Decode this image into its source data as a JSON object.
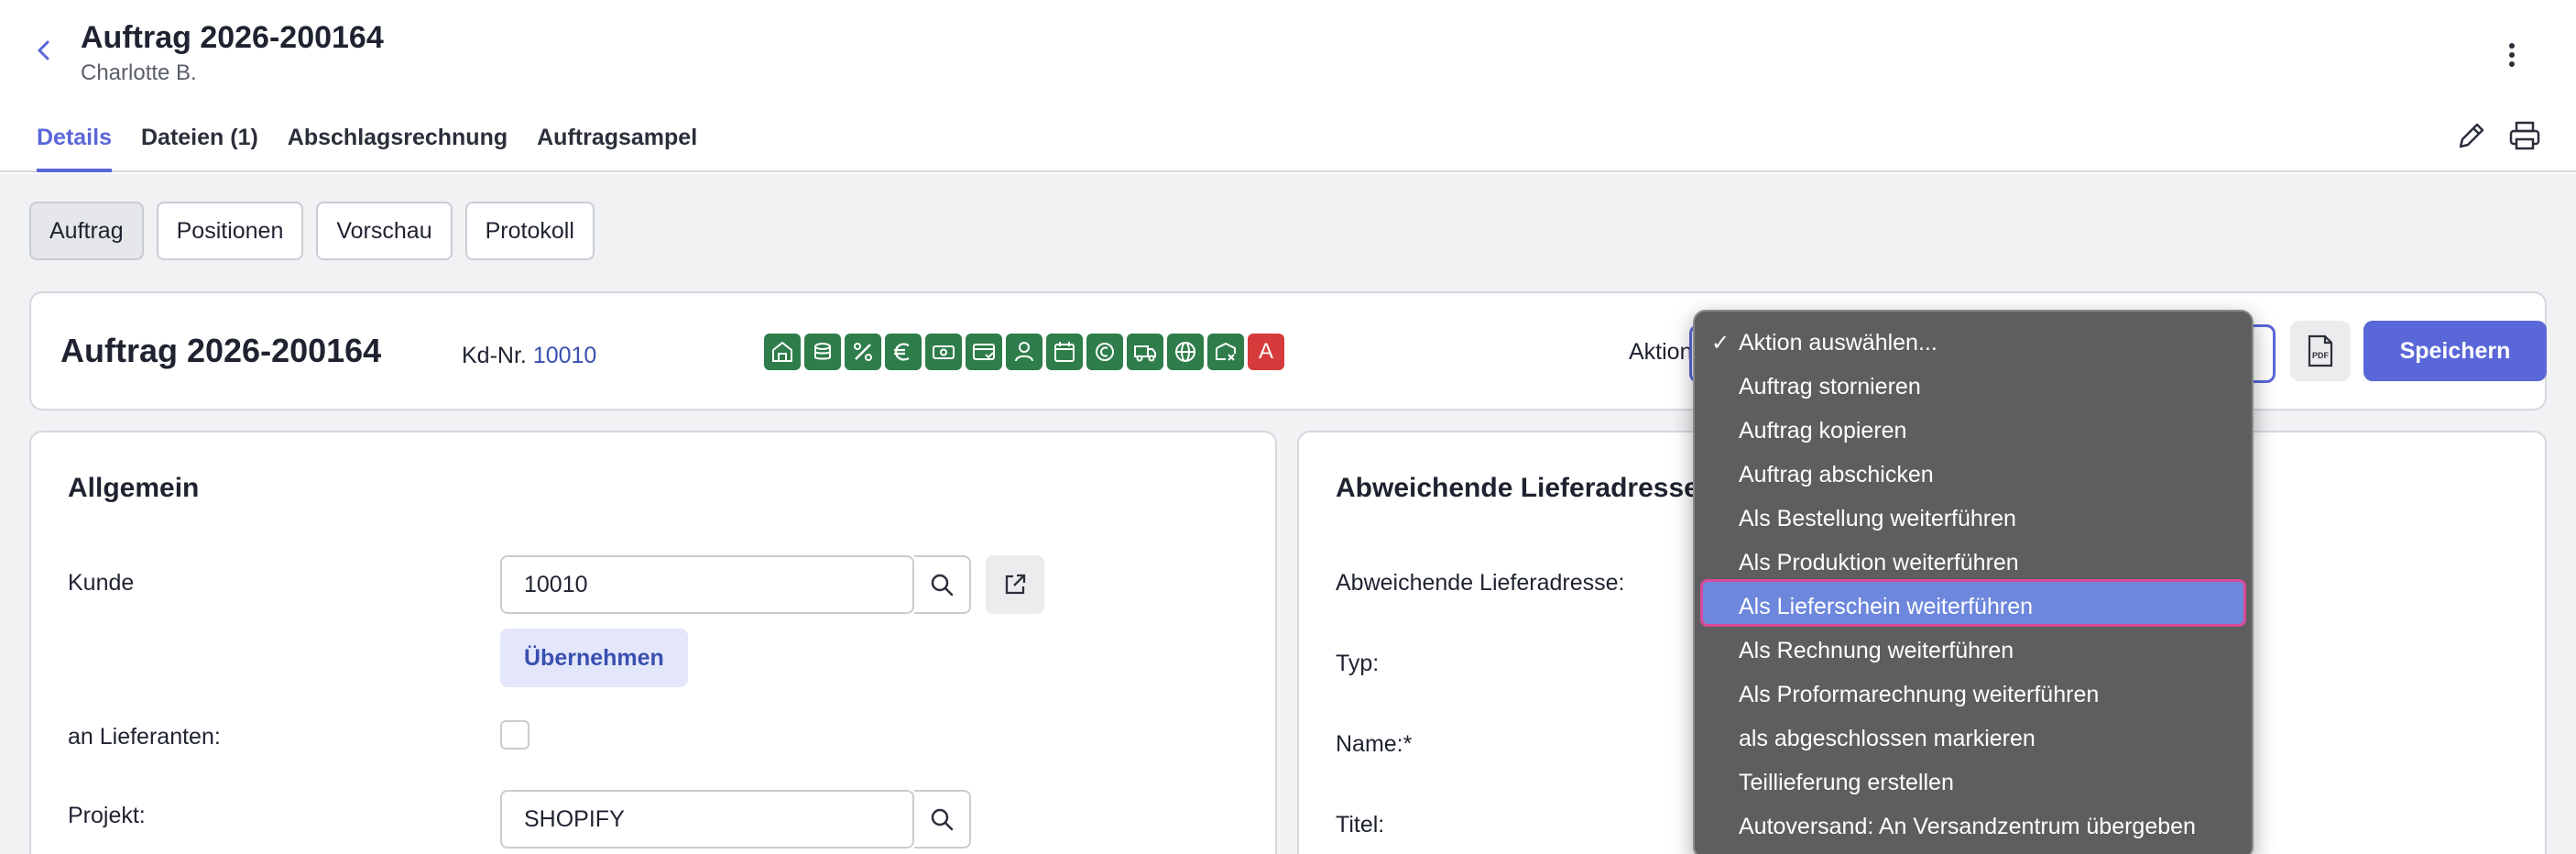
{
  "header": {
    "title": "Auftrag 2026-200164",
    "subtitle": "Charlotte B.",
    "tabs": [
      {
        "label": "Details",
        "active": true
      },
      {
        "label": "Dateien (1)",
        "active": false
      },
      {
        "label": "Abschlagsrechnung",
        "active": false
      },
      {
        "label": "Auftragsampel",
        "active": false
      }
    ]
  },
  "subtabs": [
    {
      "label": "Auftrag",
      "active": true
    },
    {
      "label": "Positionen",
      "active": false
    },
    {
      "label": "Vorschau",
      "active": false
    },
    {
      "label": "Protokoll",
      "active": false
    }
  ],
  "summary": {
    "title": "Auftrag 2026-200164",
    "kd_label": "Kd-Nr.",
    "kd_value": "10010",
    "status_badges": [
      "store-icon",
      "coins-icon",
      "percent-icon",
      "euro-icon",
      "cash-icon",
      "card-icon",
      "person-icon",
      "calendar-icon",
      "payment-icon",
      "truck-icon",
      "globe-icon",
      "cancel-box-icon"
    ],
    "status_letter_badge": "A",
    "aktion_label": "Aktion",
    "pdf_label": "PDF",
    "save_label": "Speichern",
    "accent_color": "#5a67d8",
    "badge_color": "#2e7d4a",
    "badge_alert_color": "#d63b3b"
  },
  "allgemein": {
    "heading": "Allgemein",
    "kunde_label": "Kunde",
    "kunde_value": "10010",
    "uebernehmen_label": "Übernehmen",
    "lieferanten_label": "an Lieferanten:",
    "projekt_label": "Projekt:",
    "projekt_value": "SHOPIFY"
  },
  "lieferadresse": {
    "heading": "Abweichende Lieferadresse",
    "abw_label": "Abweichende Lieferadresse:",
    "typ_label": "Typ:",
    "name_label": "Name:*",
    "titel_label": "Titel:"
  },
  "dropdown": {
    "options": [
      {
        "label": "Aktion auswählen...",
        "selected": true
      },
      {
        "label": "Auftrag stornieren",
        "selected": false
      },
      {
        "label": "Auftrag kopieren",
        "selected": false
      },
      {
        "label": "Auftrag abschicken",
        "selected": false
      },
      {
        "label": "Als Bestellung weiterführen",
        "selected": false
      },
      {
        "label": "Als Produktion weiterführen",
        "selected": false
      },
      {
        "label": "Als Lieferschein weiterführen",
        "selected": false,
        "highlighted": true
      },
      {
        "label": "Als Rechnung weiterführen",
        "selected": false
      },
      {
        "label": "Als Proformarechnung weiterführen",
        "selected": false
      },
      {
        "label": "als abgeschlossen markieren",
        "selected": false
      },
      {
        "label": "Teillieferung erstellen",
        "selected": false
      },
      {
        "label": "Autoversand: An Versandzentrum übergeben",
        "selected": false
      }
    ],
    "check_glyph": "✓"
  }
}
